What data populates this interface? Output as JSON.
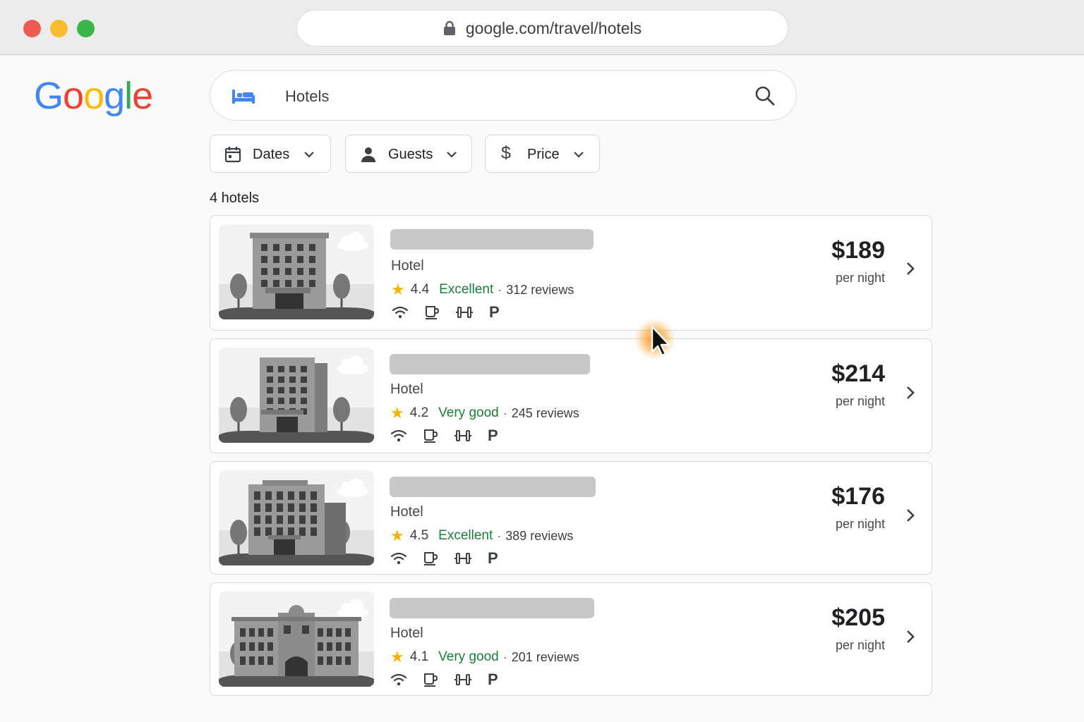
{
  "browser": {
    "url": "google.com/travel/hotels"
  },
  "brand": {
    "logo_letters": [
      "G",
      "o",
      "o",
      "g",
      "l",
      "e"
    ],
    "logo_colors": [
      "#4285F4",
      "#EA4335",
      "#FBBC05",
      "#4285F4",
      "#34A853",
      "#EA4335"
    ]
  },
  "search": {
    "query": "Hotels",
    "icon": "bed-icon",
    "submit_icon": "search-icon"
  },
  "filters": [
    {
      "label": "Dates",
      "icon": "calendar-icon"
    },
    {
      "label": "Guests",
      "icon": "person-icon"
    },
    {
      "label": "Price",
      "icon": "dollar-icon"
    }
  ],
  "results": {
    "count_label": "4 hotels",
    "hotels": [
      {
        "type": "Hotel",
        "score": "4.4",
        "rating_word": "Excellent",
        "reviews": "312 reviews",
        "price": "$189",
        "price_unit": "per night"
      },
      {
        "type": "Hotel",
        "score": "4.2",
        "rating_word": "Very good",
        "reviews": "245 reviews",
        "price": "$214",
        "price_unit": "per night"
      },
      {
        "type": "Hotel",
        "score": "4.5",
        "rating_word": "Excellent",
        "reviews": "389 reviews",
        "price": "$176",
        "price_unit": "per night"
      },
      {
        "type": "Hotel",
        "score": "4.1",
        "rating_word": "Very good",
        "reviews": "201 reviews",
        "price": "$205",
        "price_unit": "per night"
      }
    ],
    "amenity_icons": [
      "wifi-icon",
      "coffee-icon",
      "fitness-icon",
      "parking-icon"
    ],
    "parking_glyph": "P"
  },
  "colors": {
    "rating_word": "#188038",
    "star": "#F4B400",
    "accent_blue": "#4285F4"
  }
}
